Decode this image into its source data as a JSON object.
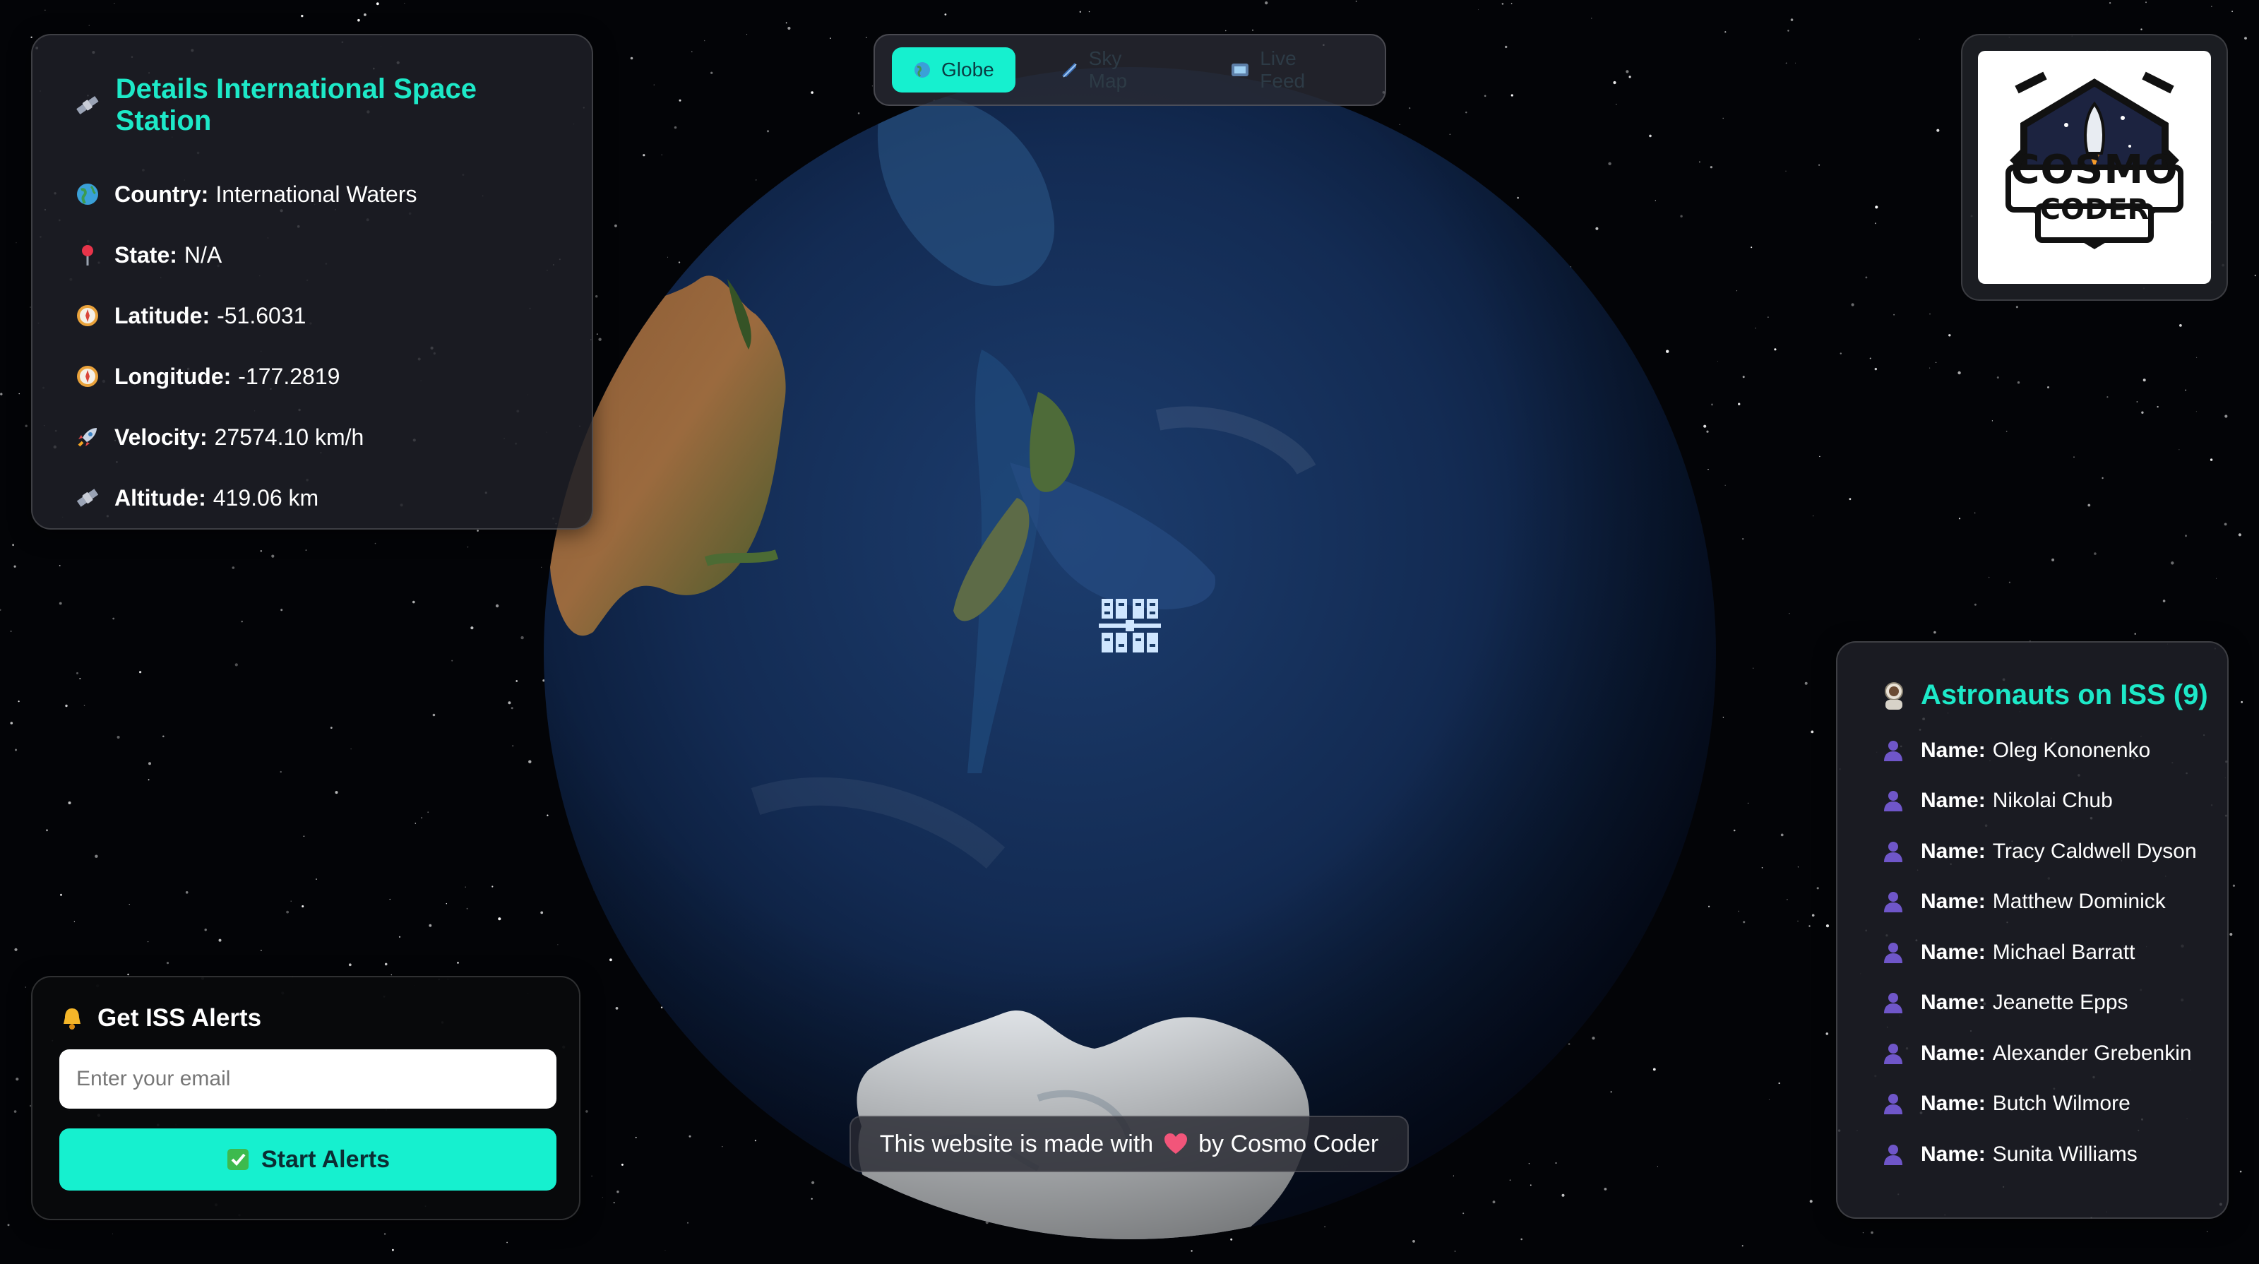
{
  "nav": {
    "tabs": [
      {
        "label": "Globe",
        "icon": "globe-icon",
        "active": true
      },
      {
        "label": "Sky Map",
        "icon": "sky-map-icon",
        "active": false
      },
      {
        "label": "Live Feed",
        "icon": "live-feed-icon",
        "active": false
      }
    ]
  },
  "iss_details": {
    "title": "Details International Space Station",
    "rows": [
      {
        "label": "Country:",
        "value": "International Waters",
        "icon": "globe-icon"
      },
      {
        "label": "State:",
        "value": "N/A",
        "icon": "pin-icon"
      },
      {
        "label": "Latitude:",
        "value": "-51.6031",
        "icon": "compass-icon"
      },
      {
        "label": "Longitude:",
        "value": "-177.2819",
        "icon": "compass-icon"
      },
      {
        "label": "Velocity:",
        "value": "27574.10 km/h",
        "icon": "rocket-icon"
      },
      {
        "label": "Altitude:",
        "value": "419.06 km",
        "icon": "satellite-icon"
      }
    ]
  },
  "logo": {
    "line1": "COSMO",
    "line2": "CODER"
  },
  "astronauts": {
    "title": "Astronauts on ISS (9)",
    "label": "Name:",
    "names": [
      "Oleg Kononenko",
      "Nikolai Chub",
      "Tracy Caldwell Dyson",
      "Matthew Dominick",
      "Michael Barratt",
      "Jeanette Epps",
      "Alexander Grebenkin",
      "Butch Wilmore",
      "Sunita Williams"
    ]
  },
  "alerts": {
    "title": "Get ISS Alerts",
    "email_placeholder": "Enter your email",
    "button_label": "Start Alerts"
  },
  "footer": {
    "before": "This website is made with",
    "after": "by Cosmo Coder"
  },
  "colors": {
    "accent": "#16f0cf",
    "title": "#1de9c8",
    "background": "#030407",
    "panel": "#1e2026"
  }
}
